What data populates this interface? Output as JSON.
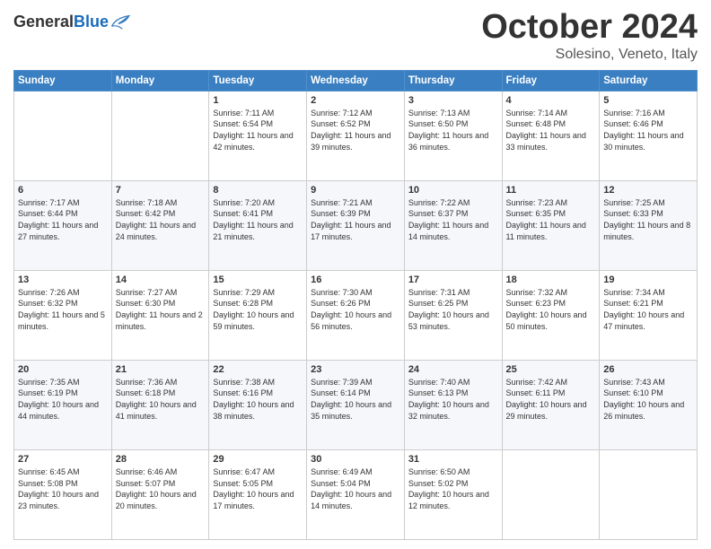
{
  "header": {
    "logo_general": "General",
    "logo_blue": "Blue",
    "title": "October 2024",
    "location": "Solesino, Veneto, Italy"
  },
  "weekdays": [
    "Sunday",
    "Monday",
    "Tuesday",
    "Wednesday",
    "Thursday",
    "Friday",
    "Saturday"
  ],
  "weeks": [
    [
      {
        "day": "",
        "info": ""
      },
      {
        "day": "",
        "info": ""
      },
      {
        "day": "1",
        "info": "Sunrise: 7:11 AM\nSunset: 6:54 PM\nDaylight: 11 hours and 42 minutes."
      },
      {
        "day": "2",
        "info": "Sunrise: 7:12 AM\nSunset: 6:52 PM\nDaylight: 11 hours and 39 minutes."
      },
      {
        "day": "3",
        "info": "Sunrise: 7:13 AM\nSunset: 6:50 PM\nDaylight: 11 hours and 36 minutes."
      },
      {
        "day": "4",
        "info": "Sunrise: 7:14 AM\nSunset: 6:48 PM\nDaylight: 11 hours and 33 minutes."
      },
      {
        "day": "5",
        "info": "Sunrise: 7:16 AM\nSunset: 6:46 PM\nDaylight: 11 hours and 30 minutes."
      }
    ],
    [
      {
        "day": "6",
        "info": "Sunrise: 7:17 AM\nSunset: 6:44 PM\nDaylight: 11 hours and 27 minutes."
      },
      {
        "day": "7",
        "info": "Sunrise: 7:18 AM\nSunset: 6:42 PM\nDaylight: 11 hours and 24 minutes."
      },
      {
        "day": "8",
        "info": "Sunrise: 7:20 AM\nSunset: 6:41 PM\nDaylight: 11 hours and 21 minutes."
      },
      {
        "day": "9",
        "info": "Sunrise: 7:21 AM\nSunset: 6:39 PM\nDaylight: 11 hours and 17 minutes."
      },
      {
        "day": "10",
        "info": "Sunrise: 7:22 AM\nSunset: 6:37 PM\nDaylight: 11 hours and 14 minutes."
      },
      {
        "day": "11",
        "info": "Sunrise: 7:23 AM\nSunset: 6:35 PM\nDaylight: 11 hours and 11 minutes."
      },
      {
        "day": "12",
        "info": "Sunrise: 7:25 AM\nSunset: 6:33 PM\nDaylight: 11 hours and 8 minutes."
      }
    ],
    [
      {
        "day": "13",
        "info": "Sunrise: 7:26 AM\nSunset: 6:32 PM\nDaylight: 11 hours and 5 minutes."
      },
      {
        "day": "14",
        "info": "Sunrise: 7:27 AM\nSunset: 6:30 PM\nDaylight: 11 hours and 2 minutes."
      },
      {
        "day": "15",
        "info": "Sunrise: 7:29 AM\nSunset: 6:28 PM\nDaylight: 10 hours and 59 minutes."
      },
      {
        "day": "16",
        "info": "Sunrise: 7:30 AM\nSunset: 6:26 PM\nDaylight: 10 hours and 56 minutes."
      },
      {
        "day": "17",
        "info": "Sunrise: 7:31 AM\nSunset: 6:25 PM\nDaylight: 10 hours and 53 minutes."
      },
      {
        "day": "18",
        "info": "Sunrise: 7:32 AM\nSunset: 6:23 PM\nDaylight: 10 hours and 50 minutes."
      },
      {
        "day": "19",
        "info": "Sunrise: 7:34 AM\nSunset: 6:21 PM\nDaylight: 10 hours and 47 minutes."
      }
    ],
    [
      {
        "day": "20",
        "info": "Sunrise: 7:35 AM\nSunset: 6:19 PM\nDaylight: 10 hours and 44 minutes."
      },
      {
        "day": "21",
        "info": "Sunrise: 7:36 AM\nSunset: 6:18 PM\nDaylight: 10 hours and 41 minutes."
      },
      {
        "day": "22",
        "info": "Sunrise: 7:38 AM\nSunset: 6:16 PM\nDaylight: 10 hours and 38 minutes."
      },
      {
        "day": "23",
        "info": "Sunrise: 7:39 AM\nSunset: 6:14 PM\nDaylight: 10 hours and 35 minutes."
      },
      {
        "day": "24",
        "info": "Sunrise: 7:40 AM\nSunset: 6:13 PM\nDaylight: 10 hours and 32 minutes."
      },
      {
        "day": "25",
        "info": "Sunrise: 7:42 AM\nSunset: 6:11 PM\nDaylight: 10 hours and 29 minutes."
      },
      {
        "day": "26",
        "info": "Sunrise: 7:43 AM\nSunset: 6:10 PM\nDaylight: 10 hours and 26 minutes."
      }
    ],
    [
      {
        "day": "27",
        "info": "Sunrise: 6:45 AM\nSunset: 5:08 PM\nDaylight: 10 hours and 23 minutes."
      },
      {
        "day": "28",
        "info": "Sunrise: 6:46 AM\nSunset: 5:07 PM\nDaylight: 10 hours and 20 minutes."
      },
      {
        "day": "29",
        "info": "Sunrise: 6:47 AM\nSunset: 5:05 PM\nDaylight: 10 hours and 17 minutes."
      },
      {
        "day": "30",
        "info": "Sunrise: 6:49 AM\nSunset: 5:04 PM\nDaylight: 10 hours and 14 minutes."
      },
      {
        "day": "31",
        "info": "Sunrise: 6:50 AM\nSunset: 5:02 PM\nDaylight: 10 hours and 12 minutes."
      },
      {
        "day": "",
        "info": ""
      },
      {
        "day": "",
        "info": ""
      }
    ]
  ]
}
